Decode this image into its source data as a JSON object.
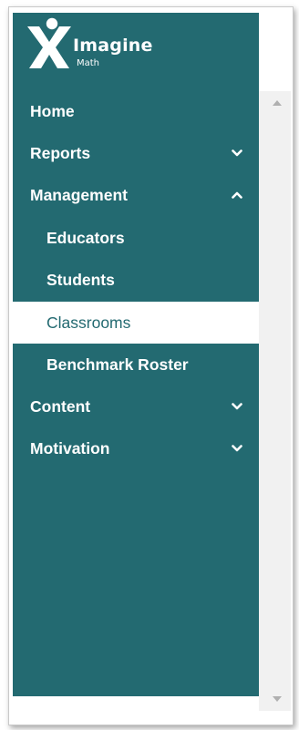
{
  "app": {
    "brand_name": "Imagine",
    "brand_sub": "Math"
  },
  "colors": {
    "sidebar_bg": "#236a71",
    "active_bg": "#ffffff",
    "active_text": "#236a71",
    "text": "#ffffff"
  },
  "nav": {
    "items": [
      {
        "label": "Home",
        "level": 1,
        "expandable": false
      },
      {
        "label": "Reports",
        "level": 1,
        "expandable": true,
        "expanded": false,
        "icon": "chevron-down-icon"
      },
      {
        "label": "Management",
        "level": 1,
        "expandable": true,
        "expanded": true,
        "icon": "chevron-up-icon"
      },
      {
        "label": "Educators",
        "level": 2
      },
      {
        "label": "Students",
        "level": 2
      },
      {
        "label": "Classrooms",
        "level": 2,
        "active": true
      },
      {
        "label": "Benchmark Roster",
        "level": 2
      },
      {
        "label": "Content",
        "level": 1,
        "expandable": true,
        "expanded": false,
        "icon": "chevron-down-icon"
      },
      {
        "label": "Motivation",
        "level": 1,
        "expandable": true,
        "expanded": false,
        "icon": "chevron-down-icon"
      }
    ]
  }
}
